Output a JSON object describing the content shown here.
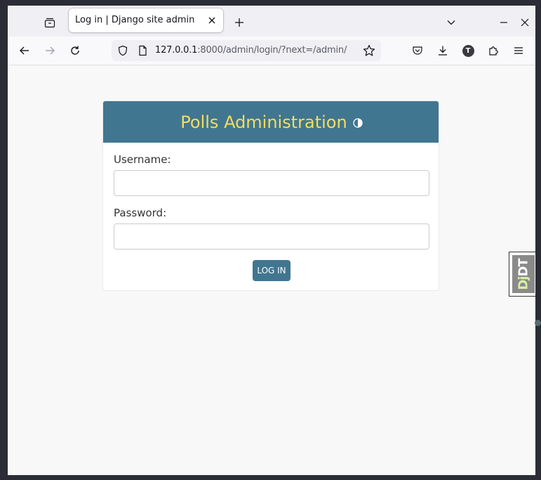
{
  "browser": {
    "tab": {
      "title": "Log in | Django site admin"
    },
    "url": {
      "host": "127.0.0.1",
      "rest": ":8000/admin/login/?next=/admin/"
    },
    "icons": {
      "tab_manager": "tab-manager-icon",
      "close_tab": "close-icon",
      "new_tab": "plus-icon",
      "list_all_tabs": "chevron-down-icon",
      "minimize": "minimize-icon",
      "close_window": "close-icon",
      "back": "arrow-left-icon",
      "forward": "arrow-right-icon",
      "reload": "reload-icon",
      "site_info": "shield-icon",
      "page": "page-icon",
      "bookmark": "star-icon",
      "pocket": "pocket-icon",
      "downloads": "download-icon",
      "account": "account-icon",
      "extensions": "puzzle-icon",
      "menu": "hamburger-menu-icon"
    },
    "account_initial": "T"
  },
  "login": {
    "site_name": "Polls Administration",
    "username_label": "Username:",
    "password_label": "Password:",
    "submit_label": "LOG IN",
    "username_value": "",
    "password_value": ""
  },
  "djdt": {
    "label_dj": "Dj",
    "label_dt": "DT"
  },
  "colors": {
    "header_bg": "#417690",
    "site_name": "#f5dd5d",
    "button_bg": "#417690",
    "button_text": "#ffffff",
    "page_bg": "#f8f8f8"
  }
}
